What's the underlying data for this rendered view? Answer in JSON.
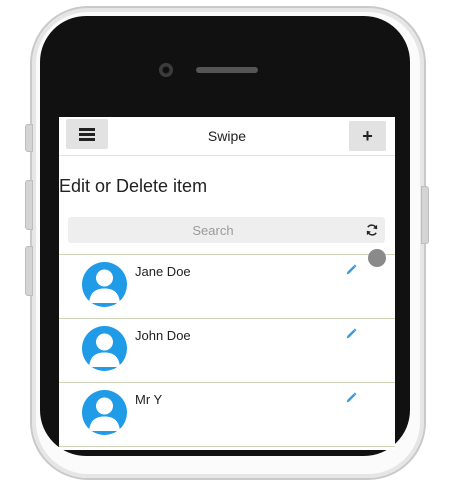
{
  "header": {
    "title": "Swipe",
    "add_label": "+"
  },
  "page": {
    "heading": "Edit or Delete item"
  },
  "search": {
    "placeholder": "Search"
  },
  "list": {
    "items": [
      {
        "name": "Jane Doe"
      },
      {
        "name": "John Doe"
      },
      {
        "name": "Mr Y"
      }
    ]
  },
  "icons": {
    "menu": "hamburger-icon",
    "add": "plus-icon",
    "refresh": "refresh-icon",
    "edit": "pencil-icon",
    "avatar": "user-silhouette-icon"
  },
  "colors": {
    "accent": "#1f9be8",
    "button_bg": "#e2e2e2",
    "divider": "#cfd3b8"
  }
}
